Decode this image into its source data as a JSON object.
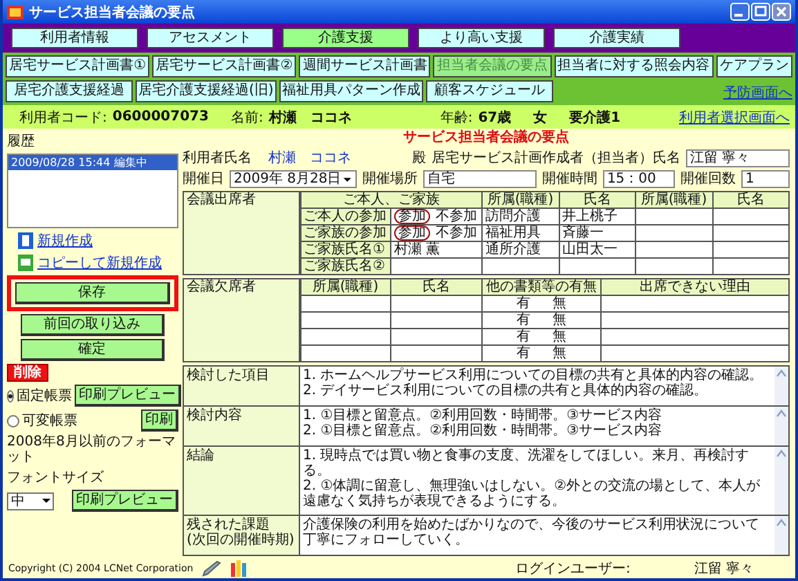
{
  "window": {
    "title": "サービス担当者会議の要点"
  },
  "main_tabs": [
    {
      "label": "利用者情報",
      "selected": false
    },
    {
      "label": "アセスメント",
      "selected": false
    },
    {
      "label": "介護支援",
      "selected": true
    },
    {
      "label": "より高い支援",
      "selected": false
    },
    {
      "label": "介護実績",
      "selected": false
    }
  ],
  "sub_tabs_row1": [
    {
      "label": "居宅サービス計画書①",
      "selected": false
    },
    {
      "label": "居宅サービス計画書②",
      "selected": false
    },
    {
      "label": "週間サービス計画書",
      "selected": false
    },
    {
      "label": "担当者会議の要点",
      "selected": true
    },
    {
      "label": "担当者に対する照会内容",
      "selected": false
    },
    {
      "label": "ケアプラン",
      "selected": false
    }
  ],
  "sub_tabs_row2": [
    {
      "label": "居宅介護支援経過",
      "selected": false
    },
    {
      "label": "居宅介護支援経過(旧)",
      "selected": false
    },
    {
      "label": "福祉用具パターン作成",
      "selected": false
    },
    {
      "label": "顧客スケジュール",
      "selected": false
    }
  ],
  "prevention_link": "予防画面へ",
  "user_bar": {
    "code_label": "利用者コード:",
    "code": "0600007073",
    "name_label": "名前:",
    "name": "村瀬　ココネ",
    "age_label": "年齢:",
    "age": "67歳",
    "sex": "女",
    "care_level": "要介護1",
    "link": "利用者選択画面へ"
  },
  "sidebar": {
    "history_label": "履歴",
    "history": [
      {
        "text": "2009/08/28 15:44 編集中",
        "selected": true
      }
    ],
    "links": [
      {
        "kind": "new",
        "label": "新規作成"
      },
      {
        "kind": "copy",
        "label": "コピーして新規作成"
      }
    ],
    "buttons": [
      {
        "label": "保存",
        "highlighted": true
      },
      {
        "label": "前回の取り込み",
        "highlighted": false
      },
      {
        "label": "確定",
        "highlighted": false
      }
    ],
    "delete_button": "削除",
    "print_options": [
      {
        "label": "固定帳票",
        "selected": true,
        "button": "印刷プレビュー"
      },
      {
        "label": "可変帳票",
        "selected": false,
        "button": "印刷"
      }
    ],
    "legacy_note": "2008年8月以前のフォーマット",
    "font_size_label": "フォントサイズ",
    "font_size": "中",
    "legacy_button": "印刷プレビュー"
  },
  "form": {
    "heading": "サービス担当者会議の要点",
    "user_name_label": "利用者氏名",
    "user_name": "村瀬　ココネ",
    "honorific": "殿",
    "planner_label": "居宅サービス計画作成者（担当者）氏名",
    "planner": "江留 寧々",
    "date_label": "開催日",
    "date": "2009年 8月28日",
    "place_label": "開催場所",
    "place": "自宅",
    "time_label": "開催時間",
    "time": "15：00",
    "count_label": "開催回数",
    "count": "1",
    "attendees": {
      "label": "会議出席者",
      "family_header": "ご本人、ご家族",
      "columns": [
        "所属(職種)",
        "氏名",
        "所属(職種)",
        "氏名"
      ],
      "family_rows": [
        {
          "label": "ご本人の参加",
          "kind": "attendance",
          "options": [
            {
              "label": "参加",
              "selected": true
            },
            {
              "label": "不参加",
              "selected": false
            }
          ]
        },
        {
          "label": "ご家族の参加",
          "kind": "attendance",
          "options": [
            {
              "label": "参加",
              "selected": true
            },
            {
              "label": "不参加",
              "selected": false
            }
          ]
        },
        {
          "label": "ご家族氏名①",
          "kind": "name",
          "value": "村瀬 薫"
        },
        {
          "label": "ご家族氏名②",
          "kind": "name"
        }
      ],
      "staff_rows": [
        {
          "affiliation": "訪問介護",
          "name": "井上桃子"
        },
        {
          "affiliation": "福祉用具",
          "name": "斉藤一"
        },
        {
          "affiliation": "通所介護",
          "name": "山田太一"
        }
      ]
    },
    "absentees": {
      "label": "会議欠席者",
      "columns": [
        "所属(職種)",
        "氏名",
        "他の書類等の有無",
        "出席できない理由"
      ],
      "rows": [
        {
          "yes": "有",
          "no": "無"
        },
        {
          "yes": "有",
          "no": "無"
        },
        {
          "yes": "有",
          "no": "無"
        },
        {
          "yes": "有",
          "no": "無"
        }
      ]
    },
    "sections": [
      {
        "label": [
          "検討した項目"
        ],
        "lines": [
          "1. ホームヘルプサービス利用についての目標の共有と具体的内容の確認。",
          "2. デイサービス利用についての目標の共有と具体的内容の確認。"
        ]
      },
      {
        "label": [
          "検討内容"
        ],
        "lines": [
          "1. ①目標と留意点。②利用回数・時間帯。③サービス内容",
          "2. ①目標と留意点。②利用回数・時間帯。③サービス内容"
        ]
      },
      {
        "label": [
          "結論"
        ],
        "lines": [
          "1. 現時点では買い物と食事の支度、洗濯をしてほしい。来月、再検討する。",
          "2. ①体調に留意し、無理強いはしない。②外との交流の場として、本人が遠慮なく気持ちが表現できるようにする。"
        ]
      },
      {
        "label": [
          "残された課題",
          "(次回の開催時期)"
        ],
        "lines": [
          "介護保険の利用を始めたばかりなので、今後のサービス利用状況について丁寧にフォローしていく。"
        ]
      }
    ]
  },
  "footer": {
    "copyright": "Copyright (C) 2004 LCNet Corporation",
    "login_label": "ログインユーザー:",
    "login_user": "江留 寧々"
  }
}
